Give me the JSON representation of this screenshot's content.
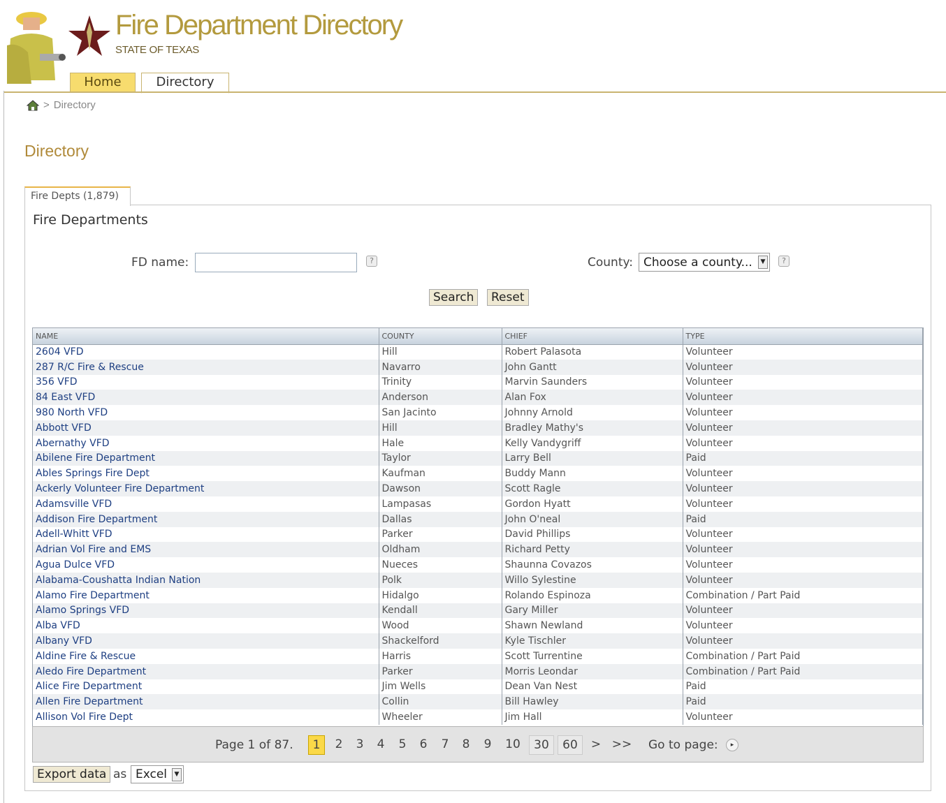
{
  "header": {
    "title": "Fire Department Directory",
    "subtitle": "STATE OF TEXAS",
    "tabs": [
      "Home",
      "Directory"
    ]
  },
  "breadcrumb": {
    "separator": ">",
    "current": "Directory"
  },
  "page_title": "Directory",
  "panel_tab": "Fire Depts (1,879)",
  "panel_heading": "Fire Departments",
  "search": {
    "fd_name_label": "FD name:",
    "fd_name_value": "",
    "county_label": "County:",
    "county_selected": "Choose a county...",
    "search_label": "Search",
    "reset_label": "Reset"
  },
  "table": {
    "columns": [
      "NAME",
      "COUNTY",
      "CHIEF",
      "TYPE"
    ],
    "rows": [
      [
        "2604 VFD",
        "Hill",
        "Robert Palasota",
        "Volunteer"
      ],
      [
        "287 R/C Fire & Rescue",
        "Navarro",
        "John Gantt",
        "Volunteer"
      ],
      [
        "356 VFD",
        "Trinity",
        "Marvin Saunders",
        "Volunteer"
      ],
      [
        "84 East VFD",
        "Anderson",
        "Alan Fox",
        "Volunteer"
      ],
      [
        "980 North VFD",
        "San Jacinto",
        "Johnny Arnold",
        "Volunteer"
      ],
      [
        "Abbott VFD",
        "Hill",
        "Bradley Mathy's",
        "Volunteer"
      ],
      [
        "Abernathy VFD",
        "Hale",
        "Kelly Vandygriff",
        "Volunteer"
      ],
      [
        "Abilene Fire Department",
        "Taylor",
        "Larry Bell",
        "Paid"
      ],
      [
        "Ables Springs Fire Dept",
        "Kaufman",
        "Buddy Mann",
        "Volunteer"
      ],
      [
        "Ackerly Volunteer Fire Department",
        "Dawson",
        "Scott Ragle",
        "Volunteer"
      ],
      [
        "Adamsville VFD",
        "Lampasas",
        "Gordon Hyatt",
        "Volunteer"
      ],
      [
        "Addison Fire Department",
        "Dallas",
        "John O'neal",
        "Paid"
      ],
      [
        "Adell-Whitt VFD",
        "Parker",
        "David Phillips",
        "Volunteer"
      ],
      [
        "Adrian Vol Fire and EMS",
        "Oldham",
        "Richard Petty",
        "Volunteer"
      ],
      [
        "Agua Dulce VFD",
        "Nueces",
        "Shaunna Covazos",
        "Volunteer"
      ],
      [
        "Alabama-Coushatta Indian Nation",
        "Polk",
        "Willo Sylestine",
        "Volunteer"
      ],
      [
        "Alamo Fire Department",
        "Hidalgo",
        "Rolando Espinoza",
        "Combination / Part Paid"
      ],
      [
        "Alamo Springs VFD",
        "Kendall",
        "Gary Miller",
        "Volunteer"
      ],
      [
        "Alba VFD",
        "Wood",
        "Shawn Newland",
        "Volunteer"
      ],
      [
        "Albany VFD",
        "Shackelford",
        "Kyle Tischler",
        "Volunteer"
      ],
      [
        "Aldine Fire & Rescue",
        "Harris",
        "Scott Turrentine",
        "Combination / Part Paid"
      ],
      [
        "Aledo Fire Department",
        "Parker",
        "Morris Leondar",
        "Combination / Part Paid"
      ],
      [
        "Alice Fire Department",
        "Jim Wells",
        "Dean Van Nest",
        "Paid"
      ],
      [
        "Allen Fire Department",
        "Collin",
        "Bill Hawley",
        "Paid"
      ],
      [
        "Allison Vol Fire Dept",
        "Wheeler",
        "Jim Hall",
        "Volunteer"
      ]
    ]
  },
  "pager": {
    "page_info": "Page 1 of 87.",
    "current": "1",
    "pages": [
      "2",
      "3",
      "4",
      "5",
      "6",
      "7",
      "8",
      "9",
      "10"
    ],
    "boxed": [
      "30",
      "60"
    ],
    "next": ">",
    "last": ">>",
    "goto_label": "Go to page:"
  },
  "export": {
    "button_label": "Export data",
    "as_label": "as",
    "format": "Excel"
  },
  "colors": {
    "title": "#b39a3e",
    "accent": "#f7dc6e",
    "link": "#1e3f82",
    "star": "#6b1c1c"
  }
}
